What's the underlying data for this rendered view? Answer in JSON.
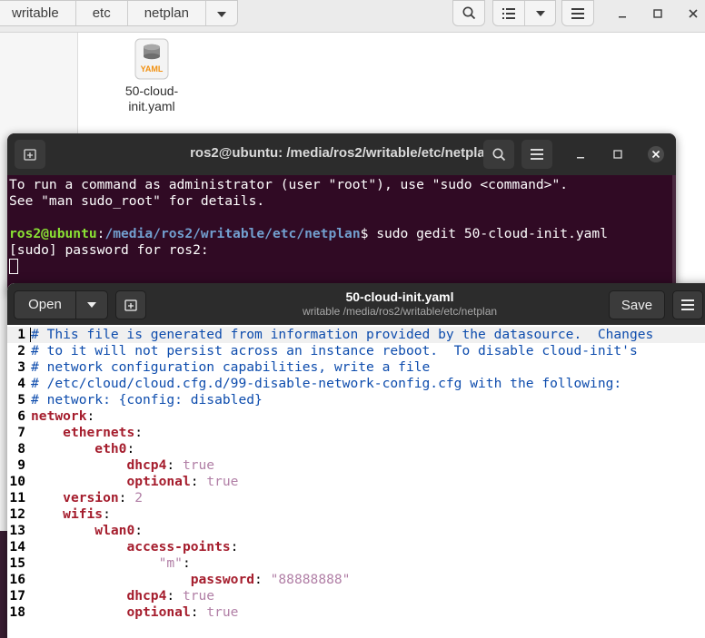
{
  "file_manager": {
    "breadcrumbs": [
      "writable",
      "etc",
      "netplan"
    ],
    "file": {
      "name_line1": "50-cloud-init.yaml",
      "label_line1": "50-cloud-",
      "label_line2": "init.yaml",
      "icon_text": "YAML"
    }
  },
  "terminal": {
    "title": "ros2@ubuntu: /media/ros2/writable/etc/netplan",
    "lines": [
      "To run a command as administrator (user \"root\"), use \"sudo <command>\".",
      "See \"man sudo_root\" for details."
    ],
    "prompt_user": "ros2@ubuntu",
    "prompt_path": "/media/ros2/writable/etc/netplan",
    "prompt_symbol": "$ ",
    "command": "sudo gedit 50-cloud-init.yaml",
    "sudo_line": "[sudo] password for ros2:"
  },
  "gedit": {
    "open_label": "Open",
    "save_label": "Save",
    "title": "50-cloud-init.yaml",
    "subtitle": "writable /media/ros2/writable/etc/netplan",
    "line_numbers": [
      "1",
      "2",
      "3",
      "4",
      "5",
      "6",
      "7",
      "8",
      "9",
      "10",
      "11",
      "12",
      "13",
      "14",
      "15",
      "16",
      "17",
      "18"
    ],
    "code": [
      [
        {
          "t": "# This file is generated from information provided by the datasource.  Changes",
          "c": "comment"
        }
      ],
      [
        {
          "t": "# to it will not persist across an instance reboot.  To disable cloud-init's",
          "c": "comment"
        }
      ],
      [
        {
          "t": "# network configuration capabilities, write a file",
          "c": "comment"
        }
      ],
      [
        {
          "t": "# /etc/cloud/cloud.cfg.d/99-disable-network-config.cfg with the following:",
          "c": "comment"
        }
      ],
      [
        {
          "t": "# network: {config: disabled}",
          "c": "comment"
        }
      ],
      [
        {
          "t": "network",
          "c": "key"
        },
        {
          "t": ":",
          "c": "punc"
        }
      ],
      [
        {
          "t": "    ",
          "c": "punc"
        },
        {
          "t": "ethernets",
          "c": "key"
        },
        {
          "t": ":",
          "c": "punc"
        }
      ],
      [
        {
          "t": "        ",
          "c": "punc"
        },
        {
          "t": "eth0",
          "c": "key"
        },
        {
          "t": ":",
          "c": "punc"
        }
      ],
      [
        {
          "t": "            ",
          "c": "punc"
        },
        {
          "t": "dhcp4",
          "c": "key"
        },
        {
          "t": ": ",
          "c": "punc"
        },
        {
          "t": "true",
          "c": "val"
        }
      ],
      [
        {
          "t": "            ",
          "c": "punc"
        },
        {
          "t": "optional",
          "c": "key"
        },
        {
          "t": ": ",
          "c": "punc"
        },
        {
          "t": "true",
          "c": "val"
        }
      ],
      [
        {
          "t": "    ",
          "c": "punc"
        },
        {
          "t": "version",
          "c": "key"
        },
        {
          "t": ": ",
          "c": "punc"
        },
        {
          "t": "2",
          "c": "val"
        }
      ],
      [
        {
          "t": "    ",
          "c": "punc"
        },
        {
          "t": "wifis",
          "c": "key"
        },
        {
          "t": ":",
          "c": "punc"
        }
      ],
      [
        {
          "t": "        ",
          "c": "punc"
        },
        {
          "t": "wlan0",
          "c": "key"
        },
        {
          "t": ":",
          "c": "punc"
        }
      ],
      [
        {
          "t": "            ",
          "c": "punc"
        },
        {
          "t": "access-points",
          "c": "key"
        },
        {
          "t": ":",
          "c": "punc"
        }
      ],
      [
        {
          "t": "                ",
          "c": "punc"
        },
        {
          "t": "\"m\"",
          "c": "val"
        },
        {
          "t": ":",
          "c": "punc"
        }
      ],
      [
        {
          "t": "                    ",
          "c": "punc"
        },
        {
          "t": "password",
          "c": "key"
        },
        {
          "t": ": ",
          "c": "punc"
        },
        {
          "t": "\"88888888\"",
          "c": "val"
        }
      ],
      [
        {
          "t": "            ",
          "c": "punc"
        },
        {
          "t": "dhcp4",
          "c": "key"
        },
        {
          "t": ": ",
          "c": "punc"
        },
        {
          "t": "true",
          "c": "val"
        }
      ],
      [
        {
          "t": "            ",
          "c": "punc"
        },
        {
          "t": "optional",
          "c": "key"
        },
        {
          "t": ": ",
          "c": "punc"
        },
        {
          "t": "true",
          "c": "val"
        }
      ]
    ]
  },
  "colors": {
    "terminal_bg": "#300a24",
    "prompt_user": "#8ae234",
    "prompt_path": "#729fcf",
    "yaml_comment": "#0d4cad",
    "yaml_key": "#a51d2d",
    "yaml_value": "#b17fa6"
  },
  "icons": [
    "search-icon",
    "view-list-icon",
    "chevron-down-icon",
    "hamburger-menu-icon",
    "minimize-icon",
    "maximize-icon",
    "close-icon",
    "new-tab-icon",
    "new-document-icon",
    "yaml-file-icon"
  ]
}
